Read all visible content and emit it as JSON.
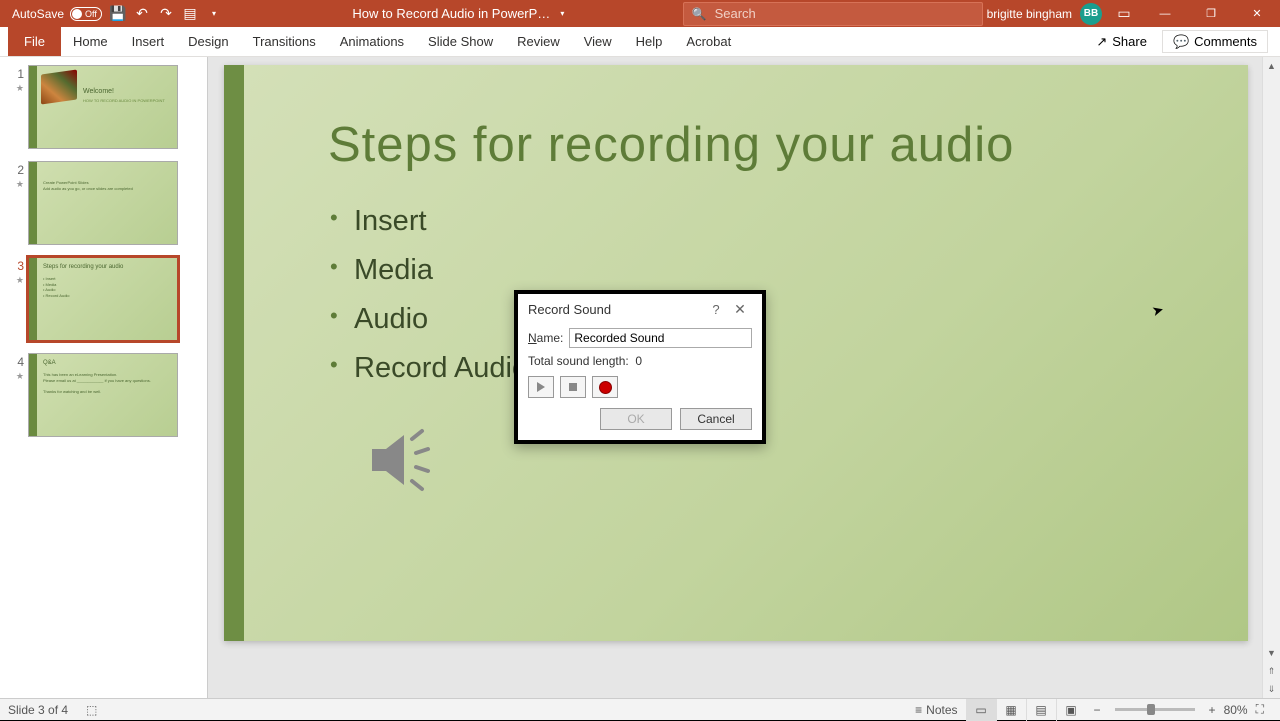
{
  "titlebar": {
    "autosave_label": "AutoSave",
    "autosave_state": "Off",
    "doc_title": "How to Record Audio in PowerP…",
    "search_placeholder": "Search",
    "user_name": "brigitte bingham",
    "user_initials": "BB"
  },
  "ribbon": {
    "tabs": [
      "File",
      "Home",
      "Insert",
      "Design",
      "Transitions",
      "Animations",
      "Slide Show",
      "Review",
      "View",
      "Help",
      "Acrobat"
    ],
    "share": "Share",
    "comments": "Comments"
  },
  "thumbnails": [
    {
      "num": "1",
      "title": "Welcome!",
      "sub": "HOW TO RECORD AUDIO IN POWERPOINT"
    },
    {
      "num": "2",
      "title": "",
      "lines": [
        "Create PowerPoint Slides",
        "Add audio as you go, or once slides are completed"
      ]
    },
    {
      "num": "3",
      "title": "Steps for recording your audio",
      "lines": [
        "Insert",
        "Media",
        "Audio",
        "Record Audio"
      ]
    },
    {
      "num": "4",
      "title": "Q&A",
      "lines": [
        "This has been an eLearning Presentation.",
        "Please email us at ____________ if you have any questions.",
        "",
        "Thanks for watching and be well."
      ]
    }
  ],
  "slide": {
    "title": "Steps for recording your audio",
    "bullets": [
      "Insert",
      "Media",
      "Audio",
      "Record Audio"
    ]
  },
  "dialog": {
    "title": "Record Sound",
    "name_label": "Name:",
    "name_value": "Recorded Sound",
    "length_label": "Total sound length:",
    "length_value": "0",
    "ok": "OK",
    "cancel": "Cancel"
  },
  "statusbar": {
    "slide_indicator": "Slide 3 of 4",
    "notes": "Notes",
    "zoom": "80%"
  }
}
